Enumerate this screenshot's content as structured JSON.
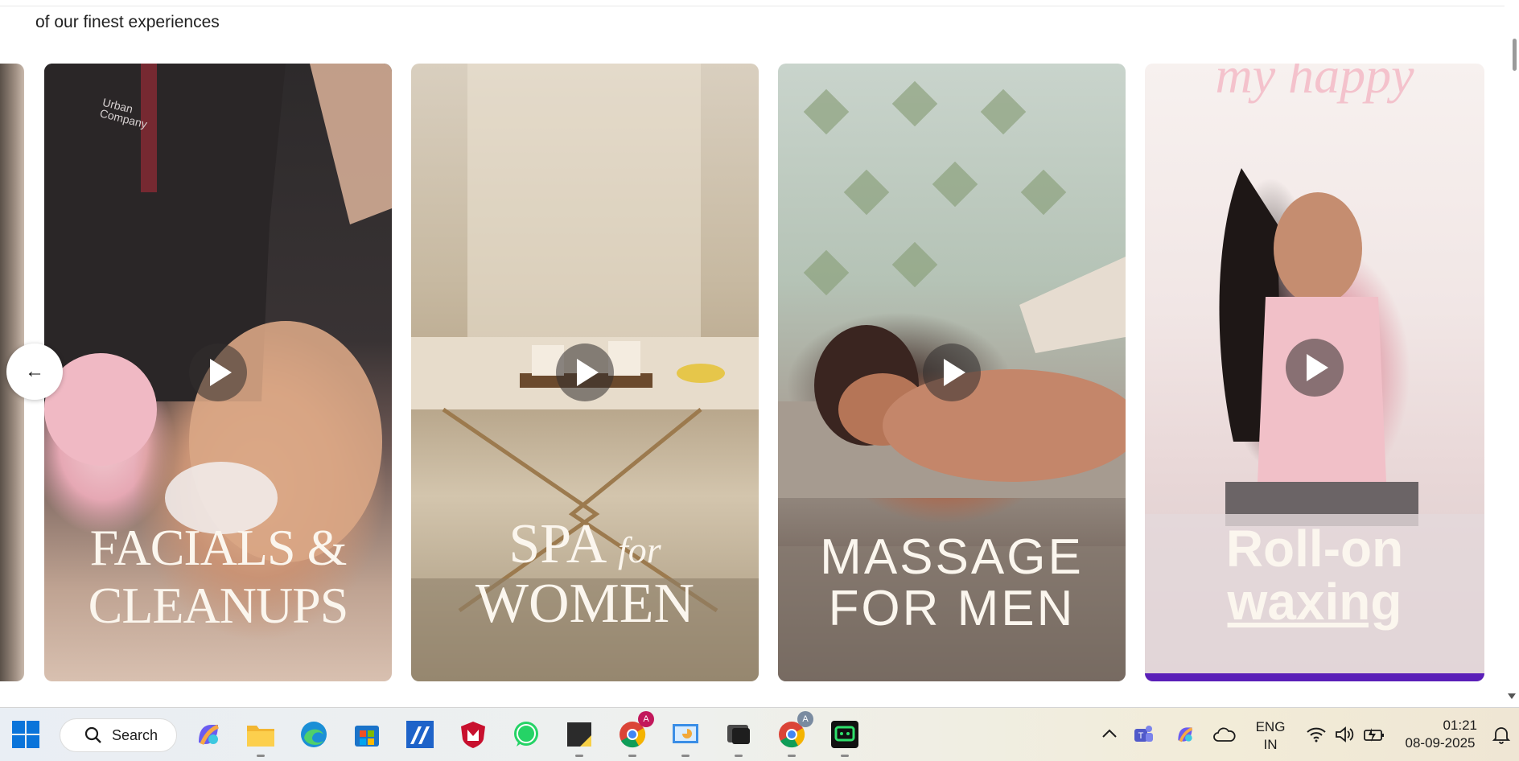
{
  "page": {
    "subtitle": "of our finest experiences"
  },
  "cards": [
    {
      "title_line1": "FACIALS &",
      "title_line2": "CLEANUPS"
    },
    {
      "title_line1a": "SPA",
      "title_line1b": "for",
      "title_line2": "WOMEN"
    },
    {
      "title_line1": "MASSAGE",
      "title_line2": "FOR MEN"
    },
    {
      "top_neon": "my happy",
      "title_line1": "Roll-on",
      "title_line2": "waxing"
    }
  ],
  "card1_shirt_logo": "Urban Company",
  "nav": {
    "prev_arrow": "←"
  },
  "taskbar": {
    "search_label": "Search",
    "chrome_badge_1": "A",
    "chrome_badge_2": "A",
    "language_top": "ENG",
    "language_bottom": "IN",
    "time": "01:21",
    "date": "08-09-2025",
    "tray_chevron": "^"
  },
  "colors": {
    "accent_bar": "#5a1fb8",
    "windows_blue": "#0a74da",
    "mcafee_red": "#c8102e",
    "whatsapp_green": "#25d366"
  }
}
